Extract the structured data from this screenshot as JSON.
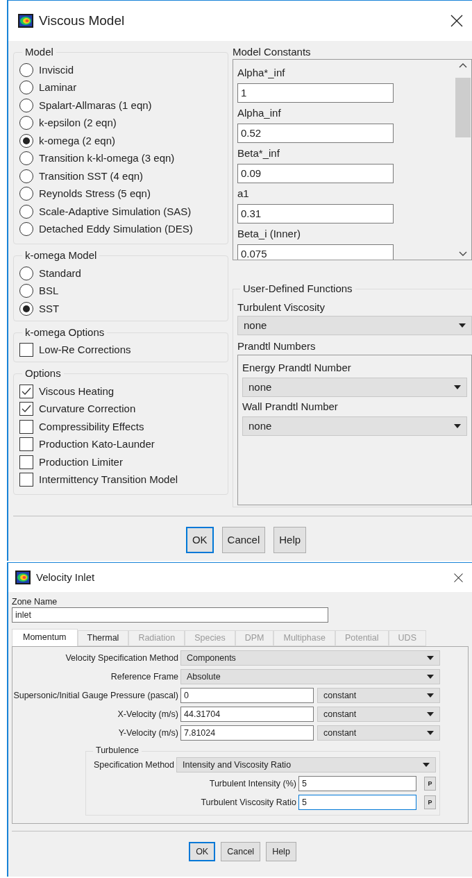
{
  "viscous_model": {
    "title": "Viscous Model",
    "model": {
      "label": "Model",
      "options": [
        {
          "label": "Inviscid",
          "selected": false
        },
        {
          "label": "Laminar",
          "selected": false
        },
        {
          "label": "Spalart-Allmaras (1 eqn)",
          "selected": false
        },
        {
          "label": "k-epsilon (2 eqn)",
          "selected": false
        },
        {
          "label": "k-omega (2 eqn)",
          "selected": true
        },
        {
          "label": "Transition k-kl-omega (3 eqn)",
          "selected": false
        },
        {
          "label": "Transition SST (4 eqn)",
          "selected": false
        },
        {
          "label": "Reynolds Stress (5 eqn)",
          "selected": false
        },
        {
          "label": "Scale-Adaptive Simulation (SAS)",
          "selected": false
        },
        {
          "label": "Detached Eddy Simulation (DES)",
          "selected": false
        }
      ]
    },
    "komega_model": {
      "label": "k-omega Model",
      "options": [
        {
          "label": "Standard",
          "selected": false
        },
        {
          "label": "BSL",
          "selected": false
        },
        {
          "label": "SST",
          "selected": true
        }
      ]
    },
    "komega_options": {
      "label": "k-omega Options",
      "items": [
        {
          "label": "Low-Re Corrections",
          "checked": false
        }
      ]
    },
    "options": {
      "label": "Options",
      "items": [
        {
          "label": "Viscous Heating",
          "checked": true
        },
        {
          "label": "Curvature Correction",
          "checked": true
        },
        {
          "label": "Compressibility Effects",
          "checked": false
        },
        {
          "label": "Production Kato-Launder",
          "checked": false
        },
        {
          "label": "Production Limiter",
          "checked": false
        },
        {
          "label": "Intermittency Transition Model",
          "checked": false
        }
      ]
    },
    "model_constants": {
      "label": "Model Constants",
      "fields": [
        {
          "label": "Alpha*_inf",
          "value": "1"
        },
        {
          "label": "Alpha_inf",
          "value": "0.52"
        },
        {
          "label": "Beta*_inf",
          "value": "0.09"
        },
        {
          "label": "a1",
          "value": "0.31"
        },
        {
          "label": "Beta_i (Inner)",
          "value": "0.075"
        }
      ]
    },
    "udf": {
      "label": "User-Defined Functions",
      "turbulent_viscosity": {
        "label": "Turbulent Viscosity",
        "value": "none"
      },
      "prandtl": {
        "label": "Prandtl Numbers",
        "fields": [
          {
            "label": "Energy Prandtl Number",
            "value": "none"
          },
          {
            "label": "Wall Prandtl Number",
            "value": "none"
          }
        ]
      }
    },
    "buttons": [
      {
        "label": "OK",
        "default": true
      },
      {
        "label": "Cancel",
        "default": false
      },
      {
        "label": "Help",
        "default": false
      }
    ]
  },
  "velocity_inlet": {
    "title": "Velocity Inlet",
    "zone_name": {
      "label": "Zone Name",
      "value": "inlet"
    },
    "tabs": [
      {
        "label": "Momentum",
        "selected": true,
        "disabled": false
      },
      {
        "label": "Thermal",
        "selected": false,
        "disabled": false
      },
      {
        "label": "Radiation",
        "selected": false,
        "disabled": true
      },
      {
        "label": "Species",
        "selected": false,
        "disabled": true
      },
      {
        "label": "DPM",
        "selected": false,
        "disabled": true
      },
      {
        "label": "Multiphase",
        "selected": false,
        "disabled": true
      },
      {
        "label": "Potential",
        "selected": false,
        "disabled": true
      },
      {
        "label": "UDS",
        "selected": false,
        "disabled": true
      }
    ],
    "rows": [
      {
        "kind": "dropdown",
        "label": "Velocity Specification Method",
        "value": "Components"
      },
      {
        "kind": "dropdown",
        "label": "Reference Frame",
        "value": "Absolute"
      },
      {
        "kind": "input",
        "label": "Supersonic/Initial Gauge Pressure (pascal)",
        "value": "0",
        "profile": "constant"
      },
      {
        "kind": "input",
        "label": "X-Velocity (m/s)",
        "value": "44.31704",
        "profile": "constant"
      },
      {
        "kind": "input",
        "label": "Y-Velocity (m/s)",
        "value": "7.81024",
        "profile": "constant"
      }
    ],
    "turbulence": {
      "label": "Turbulence",
      "method": {
        "label": "Specification Method",
        "value": "Intensity and Viscosity Ratio"
      },
      "fields": [
        {
          "label": "Turbulent Intensity (%)",
          "value": "5",
          "param": "P",
          "focused": false
        },
        {
          "label": "Turbulent Viscosity Ratio",
          "value": "5",
          "param": "P",
          "focused": true
        }
      ]
    },
    "buttons": [
      {
        "label": "OK",
        "default": true
      },
      {
        "label": "Cancel",
        "default": false
      },
      {
        "label": "Help",
        "default": false
      }
    ]
  }
}
